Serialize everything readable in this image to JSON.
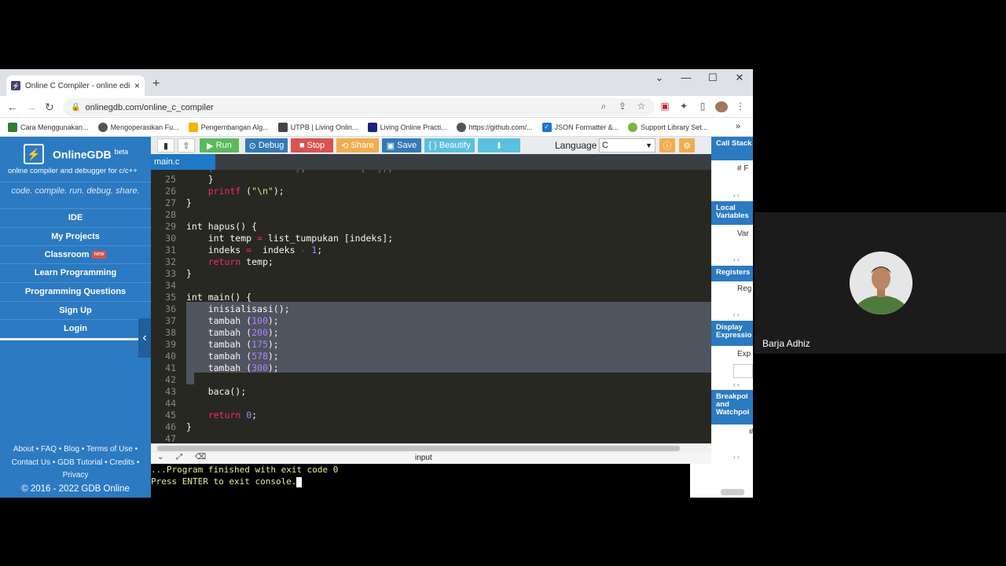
{
  "browser": {
    "tab_title": "Online C Compiler - online editor",
    "tab_close": "×",
    "new_tab": "+",
    "url": "onlinegdb.com/online_c_compiler",
    "bookmarks": [
      {
        "label": "Cara Menggunakan...",
        "color": "#2e7d32"
      },
      {
        "label": "Mengoperasikan Fu...",
        "color": "#555555"
      },
      {
        "label": "Pengembangan Alg...",
        "color": "#f4b400"
      },
      {
        "label": "UTPB | Living Onlin...",
        "color": "#444444"
      },
      {
        "label": "Living Online Practi...",
        "color": "#1a237e"
      },
      {
        "label": "https://github.com/...",
        "color": "#555555"
      },
      {
        "label": "JSON Formatter &...",
        "color": "#1976d2"
      },
      {
        "label": "Support Library Set...",
        "color": "#7cb342"
      }
    ],
    "bookmarks_more": "»"
  },
  "sidebar": {
    "brand": "OnlineGDB",
    "beta": "beta",
    "tagline": "online compiler and debugger for c/c++",
    "motto": "code. compile. run. debug. share.",
    "nav": [
      "IDE",
      "My Projects",
      "Classroom",
      "Learn Programming",
      "Programming Questions",
      "Sign Up",
      "Login"
    ],
    "new_badge": "new",
    "footer_line1": "About • FAQ • Blog • Terms of Use •",
    "footer_line2": "Contact Us • GDB Tutorial • Credits •",
    "footer_line3": "Privacy",
    "copyright": "© 2016 - 2022 GDB Online"
  },
  "toolbar": {
    "run": "Run",
    "debug": "Debug",
    "stop": "Stop",
    "share": "Share",
    "save": "Save",
    "beautify": "{ } Beautify",
    "language_label": "Language",
    "language_value": "C",
    "colors": {
      "run": "#5cb85c",
      "debug": "#337ab7",
      "stop": "#d9534f",
      "share": "#f0ad4e",
      "save": "#337ab7",
      "beautify": "#5bc0de",
      "download": "#5bc0de"
    }
  },
  "file_tab": "main.c",
  "editor": {
    "selected_lines": [
      36,
      37,
      38,
      39,
      40,
      41,
      42
    ]
  },
  "io": {
    "label": "input",
    "line1": "...Program finished with exit code 0",
    "line2": "Press ENTER to exit console."
  },
  "debug_panel": {
    "call_stack": "Call Stack",
    "call_stack_col": "# F",
    "local_variables": "Local Variables",
    "local_col": "Var",
    "registers": "Registers",
    "registers_col": "Reg",
    "display_expressions": "Display Expressio",
    "expr_col": "Exp",
    "breakpoints": "Breakpoi and Watchpoi",
    "bp_col": "#"
  },
  "webcam": {
    "name": "Barja Adhiz"
  }
}
